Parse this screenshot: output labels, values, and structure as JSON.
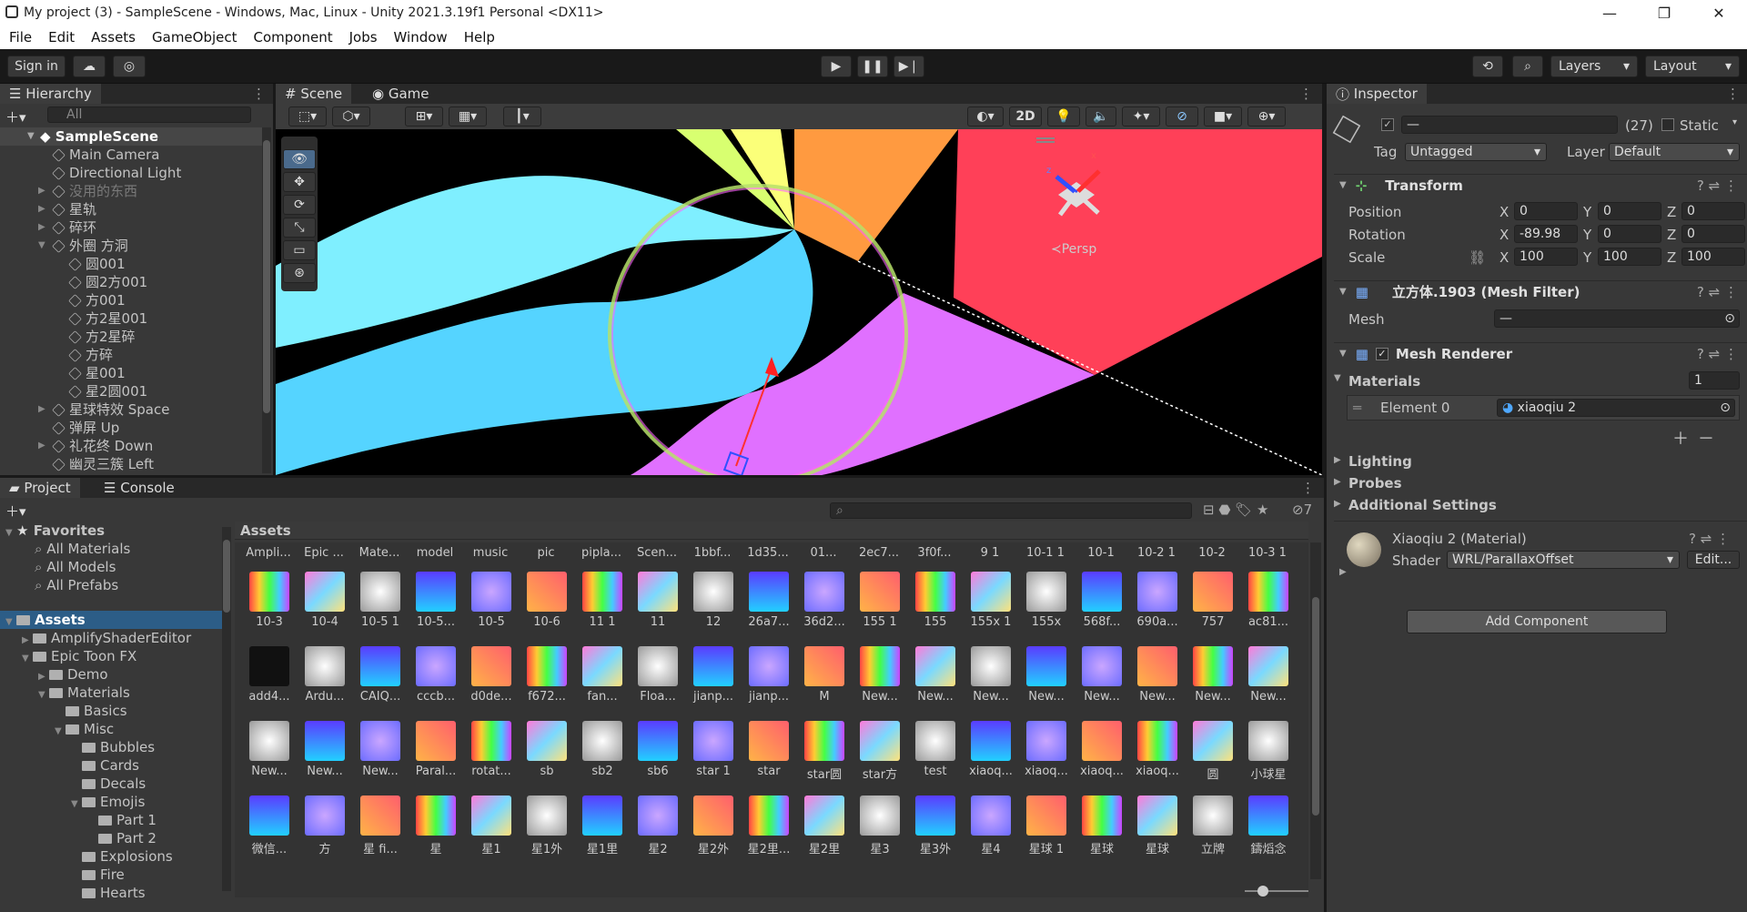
{
  "window": {
    "title": "My project (3) - SampleScene - Windows, Mac, Linux - Unity 2021.3.19f1 Personal <DX11>"
  },
  "menu": [
    "File",
    "Edit",
    "Assets",
    "GameObject",
    "Component",
    "Jobs",
    "Window",
    "Help"
  ],
  "toolbar": {
    "sign_in": "Sign in",
    "layers": "Layers",
    "layout": "Layout"
  },
  "hierarchy": {
    "tab": "Hierarchy",
    "search_placeholder": "All",
    "scene": "SampleScene",
    "items": [
      {
        "label": "Main Camera",
        "depth": 1,
        "arrow": ""
      },
      {
        "label": "Directional Light",
        "depth": 1,
        "arrow": ""
      },
      {
        "label": "没用的东西",
        "depth": 1,
        "arrow": "▶",
        "dim": true
      },
      {
        "label": "星轨",
        "depth": 1,
        "arrow": "▶"
      },
      {
        "label": "碎环",
        "depth": 1,
        "arrow": "▶"
      },
      {
        "label": "外圈 方洞",
        "depth": 1,
        "arrow": "▼"
      },
      {
        "label": "圆001",
        "depth": 2,
        "arrow": ""
      },
      {
        "label": "圆2方001",
        "depth": 2,
        "arrow": ""
      },
      {
        "label": "方001",
        "depth": 2,
        "arrow": ""
      },
      {
        "label": "方2星001",
        "depth": 2,
        "arrow": ""
      },
      {
        "label": "方2星碎",
        "depth": 2,
        "arrow": ""
      },
      {
        "label": "方碎",
        "depth": 2,
        "arrow": ""
      },
      {
        "label": "星001",
        "depth": 2,
        "arrow": ""
      },
      {
        "label": "星2圆001",
        "depth": 2,
        "arrow": ""
      },
      {
        "label": "星球特效 Space",
        "depth": 1,
        "arrow": "▶"
      },
      {
        "label": "弹屏 Up",
        "depth": 1,
        "arrow": ""
      },
      {
        "label": "礼花终 Down",
        "depth": 1,
        "arrow": "▶"
      },
      {
        "label": "幽灵三簇 Left",
        "depth": 1,
        "arrow": ""
      }
    ]
  },
  "scene": {
    "tab_scene": "Scene",
    "tab_game": "Game",
    "mode_2d": "2D",
    "persp": "≺Persp"
  },
  "inspector": {
    "tab": "Inspector",
    "obj_name": "—",
    "count": "(27)",
    "static": "Static",
    "tag_label": "Tag",
    "tag": "Untagged",
    "layer_label": "Layer",
    "layer": "Default",
    "transform": "Transform",
    "position_label": "Position",
    "rotation_label": "Rotation",
    "scale_label": "Scale",
    "position": {
      "x": "0",
      "y": "0",
      "z": "0"
    },
    "rotation": {
      "x": "-89.98",
      "y": "0",
      "z": "0"
    },
    "scale": {
      "x": "100",
      "y": "100",
      "z": "100"
    },
    "mesh_filter": "立方体.1903 (Mesh Filter)",
    "mesh_label": "Mesh",
    "mesh_value": "—",
    "mesh_renderer": "Mesh Renderer",
    "materials": "Materials",
    "materials_count": "1",
    "element0_label": "Element 0",
    "element0": "xiaoqiu 2",
    "lighting": "Lighting",
    "probes": "Probes",
    "additional": "Additional Settings",
    "material_name": "Xiaoqiu 2 (Material)",
    "shader_label": "Shader",
    "shader": "WRL/ParallaxOffset",
    "edit": "Edit...",
    "add_component": "Add Component"
  },
  "project": {
    "tab_project": "Project",
    "tab_console": "Console",
    "hidden_count": "7",
    "favorites": "Favorites",
    "fav_items": [
      "All Materials",
      "All Models",
      "All Prefabs"
    ],
    "tree": [
      {
        "label": "Assets",
        "depth": 0,
        "arrow": "▼",
        "sel": true
      },
      {
        "label": "AmplifyShaderEditor",
        "depth": 1,
        "arrow": "▶"
      },
      {
        "label": "Epic Toon FX",
        "depth": 1,
        "arrow": "▼"
      },
      {
        "label": "Demo",
        "depth": 2,
        "arrow": "▶"
      },
      {
        "label": "Materials",
        "depth": 2,
        "arrow": "▼"
      },
      {
        "label": "Basics",
        "depth": 3,
        "arrow": ""
      },
      {
        "label": "Misc",
        "depth": 3,
        "arrow": "▼"
      },
      {
        "label": "Bubbles",
        "depth": 4,
        "arrow": ""
      },
      {
        "label": "Cards",
        "depth": 4,
        "arrow": ""
      },
      {
        "label": "Decals",
        "depth": 4,
        "arrow": ""
      },
      {
        "label": "Emojis",
        "depth": 4,
        "arrow": "▼"
      },
      {
        "label": "Part 1",
        "depth": 5,
        "arrow": ""
      },
      {
        "label": "Part 2",
        "depth": 5,
        "arrow": ""
      },
      {
        "label": "Explosions",
        "depth": 4,
        "arrow": ""
      },
      {
        "label": "Fire",
        "depth": 4,
        "arrow": ""
      },
      {
        "label": "Hearts",
        "depth": 4,
        "arrow": ""
      }
    ],
    "assets_title": "Assets",
    "headers": [
      "Ampli...",
      "Epic ...",
      "Mate...",
      "model",
      "music",
      "pic",
      "pipla...",
      "Scen...",
      "1bbf...",
      "1d35...",
      "01...",
      "2ec7...",
      "3f0f...",
      "9 1",
      "10-1 1",
      "10-1",
      "10-2 1",
      "10-2",
      "10-3 1"
    ],
    "rows": [
      [
        "10-3",
        "10-4",
        "10-5 1",
        "10-5...",
        "10-5",
        "10-6",
        "11 1",
        "11",
        "12",
        "26a7...",
        "36d2...",
        "155 1",
        "155",
        "155x 1",
        "155x",
        "568f...",
        "690a...",
        "757",
        "ac81..."
      ],
      [
        "add4...",
        "Ardu...",
        "CAIQ...",
        "cccb...",
        "d0de...",
        "f672...",
        "fan...",
        "Floa...",
        "jianp...",
        "jianp...",
        "M",
        "New...",
        "New...",
        "New...",
        "New...",
        "New...",
        "New...",
        "New...",
        "New..."
      ],
      [
        "New...",
        "New...",
        "New...",
        "Paral...",
        "rotat...",
        "sb",
        "sb2",
        "sb6",
        "star 1",
        "star",
        "star圆",
        "star方",
        "test",
        "xiaoq...",
        "xiaoq...",
        "xiaoq...",
        "xiaoq...",
        "圆",
        "小球星"
      ],
      [
        "微信...",
        "方",
        "星 fi...",
        "星",
        "星1",
        "星1外",
        "星1里",
        "星2",
        "星2外",
        "星2里...",
        "星2里",
        "星3",
        "星3外",
        "星4",
        "星球 1",
        "星球",
        "星球",
        "立牌",
        "鑄熖念"
      ]
    ]
  },
  "colors": {
    "accent": "#2c5d87",
    "panel": "#383838",
    "dark": "#191919"
  }
}
